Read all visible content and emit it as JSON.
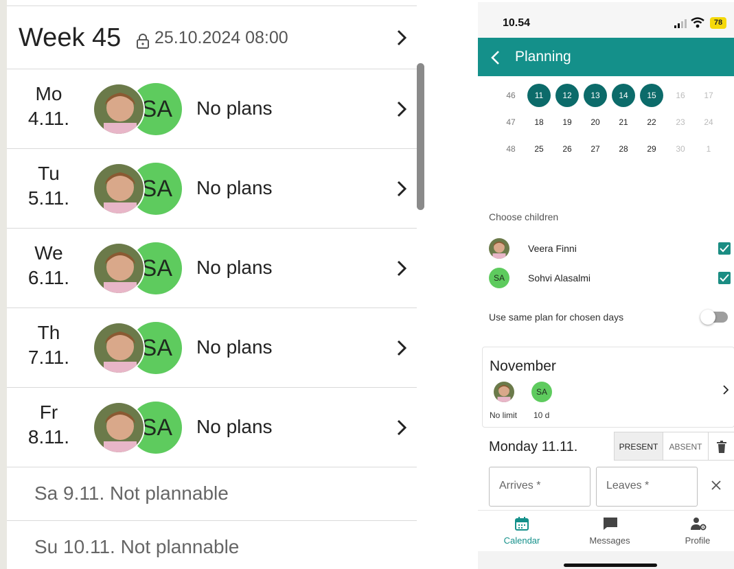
{
  "left": {
    "week": {
      "title": "Week 45",
      "locked_until": "25.10.2024 08:00",
      "lock_icon": "lock-icon"
    },
    "days": [
      {
        "name": "Mo",
        "date": "4.11.",
        "status": "No plans",
        "sa_initials": "SA"
      },
      {
        "name": "Tu",
        "date": "5.11.",
        "status": "No plans",
        "sa_initials": "SA"
      },
      {
        "name": "We",
        "date": "6.11.",
        "status": "No plans",
        "sa_initials": "SA"
      },
      {
        "name": "Th",
        "date": "7.11.",
        "status": "No plans",
        "sa_initials": "SA"
      },
      {
        "name": "Fr",
        "date": "8.11.",
        "status": "No plans",
        "sa_initials": "SA"
      }
    ],
    "not_plannable": [
      "Sa 9.11. Not plannable",
      "Su 10.11. Not plannable"
    ]
  },
  "right": {
    "status_bar": {
      "time": "10.54",
      "battery": "78"
    },
    "app_bar": {
      "title": "Planning",
      "back_icon": "back-arrow-icon"
    },
    "calendar": {
      "rows": [
        {
          "week": "46",
          "days": [
            "11",
            "12",
            "13",
            "14",
            "15",
            "16",
            "17"
          ]
        },
        {
          "week": "47",
          "days": [
            "18",
            "19",
            "20",
            "21",
            "22",
            "23",
            "24"
          ]
        },
        {
          "week": "48",
          "days": [
            "25",
            "26",
            "27",
            "28",
            "29",
            "30",
            "1"
          ]
        }
      ]
    },
    "children": {
      "label": "Choose children",
      "items": [
        {
          "name": "Veera Finni",
          "checked": true
        },
        {
          "name": "Sohvi Alasalmi",
          "initials": "SA",
          "checked": true
        }
      ]
    },
    "same_plan": {
      "label": "Use same plan for chosen days",
      "enabled": false
    },
    "month_card": {
      "title": "November",
      "child1_quota": "No limit",
      "child2_initials": "SA",
      "child2_quota": "10 d"
    },
    "day_editor": {
      "title": "Monday 11.11.",
      "present_label": "PRESENT",
      "absent_label": "ABSENT",
      "arrives_label": "Arrives *",
      "leaves_label": "Leaves *"
    },
    "bottom_nav": {
      "calendar": "Calendar",
      "messages": "Messages",
      "profile": "Profile"
    },
    "colors": {
      "teal": "#14908a",
      "selected_day": "#0c6b6a",
      "sa_green": "#5ecb5e"
    }
  }
}
